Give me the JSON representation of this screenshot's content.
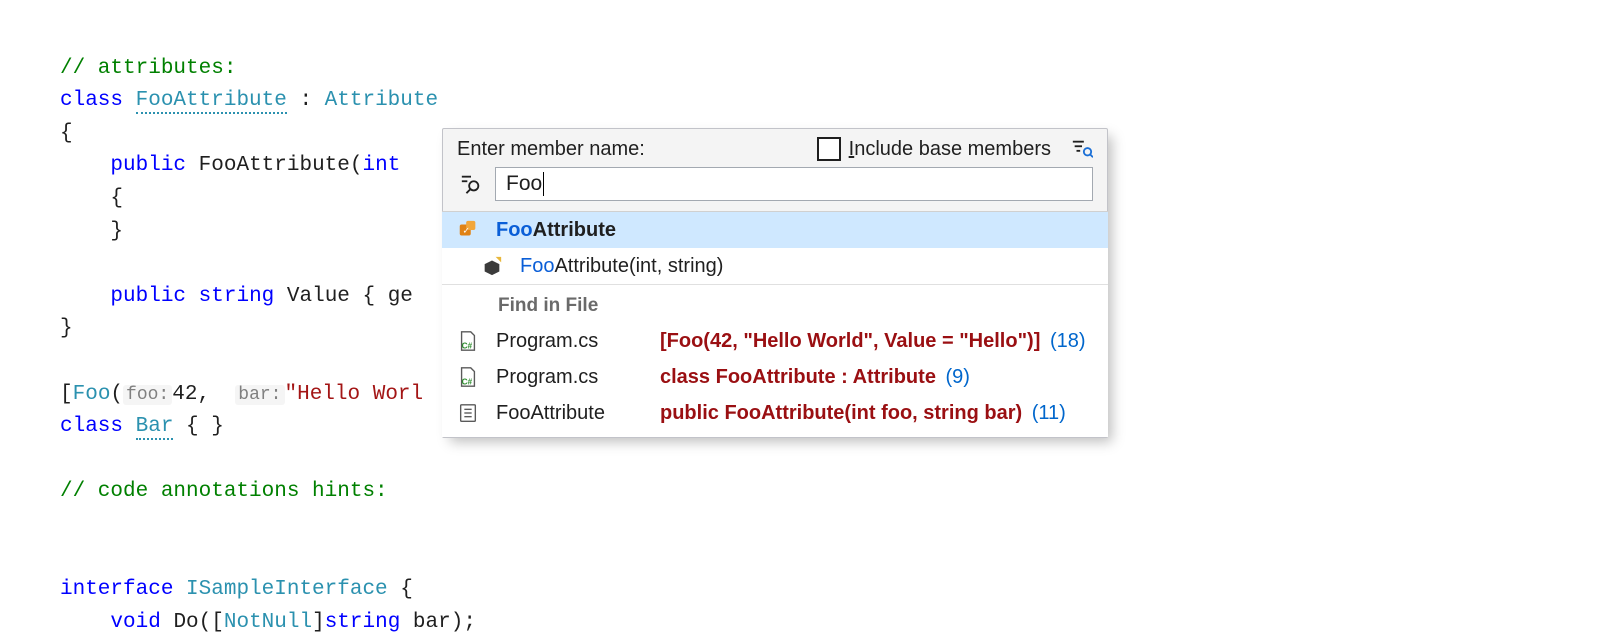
{
  "code": {
    "l1_comment": "// attributes:",
    "l2_kw_class": "class",
    "l2_type": "FooAttribute",
    "l2_sep": " : ",
    "l2_base": "Attribute",
    "l3": "{",
    "l4_kw_public": "public",
    "l4_ctor": "FooAttribute",
    "l4_open": "(",
    "l4_kw_int": "int",
    "l5": "    {",
    "l6": "    }",
    "l8_kw_public": "public",
    "l8_kw_string": "string",
    "l8_name": " Value { ge",
    "l9": "}",
    "l11_open": "[",
    "l11_name": "Foo",
    "l11_p": "(",
    "l11_hint1": "foo:",
    "l11_v1": "42, ",
    "l11_hint2": "bar:",
    "l11_v2": "\"Hello Worl",
    "l12_kw_class": "class",
    "l12_name": "Bar",
    "l12_rest": " { }",
    "l14_comment": "// code annotations hints:",
    "l17_kw_interface": "interface",
    "l17_name": "ISampleInterface",
    "l17_rest": " {",
    "l18_indent": "    ",
    "l18_kw_void": "void",
    "l18_name": " Do([",
    "l18_attr": "NotNull",
    "l18_close": "]",
    "l18_kw_string": "string",
    "l18_rest": " bar);"
  },
  "popup": {
    "label": "Enter member name:",
    "include_base": "Include base members",
    "search_value": "Foo",
    "section_find": "Find in File",
    "items": {
      "r1_match": "Foo",
      "r1_rest": "Attribute",
      "r2_match": "Foo",
      "r2_rest": "Attribute(int, string)"
    },
    "files": {
      "f1_name": "Program.cs",
      "f1_text": "[Foo(42, \"Hello World\", Value = \"Hello\")]",
      "f1_line": "(18)",
      "f2_name": "Program.cs",
      "f2_text": "class FooAttribute : Attribut",
      "f2_tail": "e",
      "f2_line": "(9)",
      "f3_name": "FooAttribute",
      "f3_lead": "    ",
      "f3_text": "public FooAttribute(int foo, string bar",
      "f3_tail": ")",
      "f3_line": "(11)"
    }
  }
}
